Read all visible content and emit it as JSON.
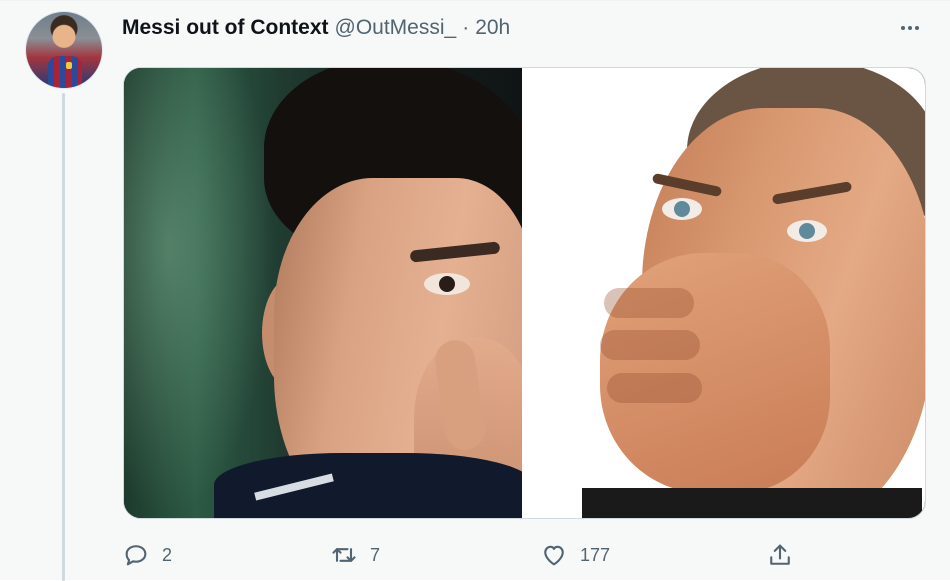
{
  "tweet": {
    "author": {
      "display_name": "Messi out of Context",
      "handle": "@OutMessi_",
      "avatar_icon": "profile-avatar"
    },
    "separator": "·",
    "time": "20h",
    "media": {
      "panels": [
        {
          "icon": "player-photo-left"
        },
        {
          "icon": "man-covering-mouth-photo-right"
        }
      ]
    },
    "actions": {
      "reply_count": "2",
      "retweet_count": "7",
      "like_count": "177"
    }
  },
  "colors": {
    "text_primary": "#0f1419",
    "text_secondary": "#536471",
    "border": "#cfd9de",
    "background": "#ffffff"
  },
  "icons": {
    "reply": "reply-icon",
    "retweet": "retweet-icon",
    "like": "heart-icon",
    "share": "share-icon",
    "more": "more-options-icon"
  }
}
